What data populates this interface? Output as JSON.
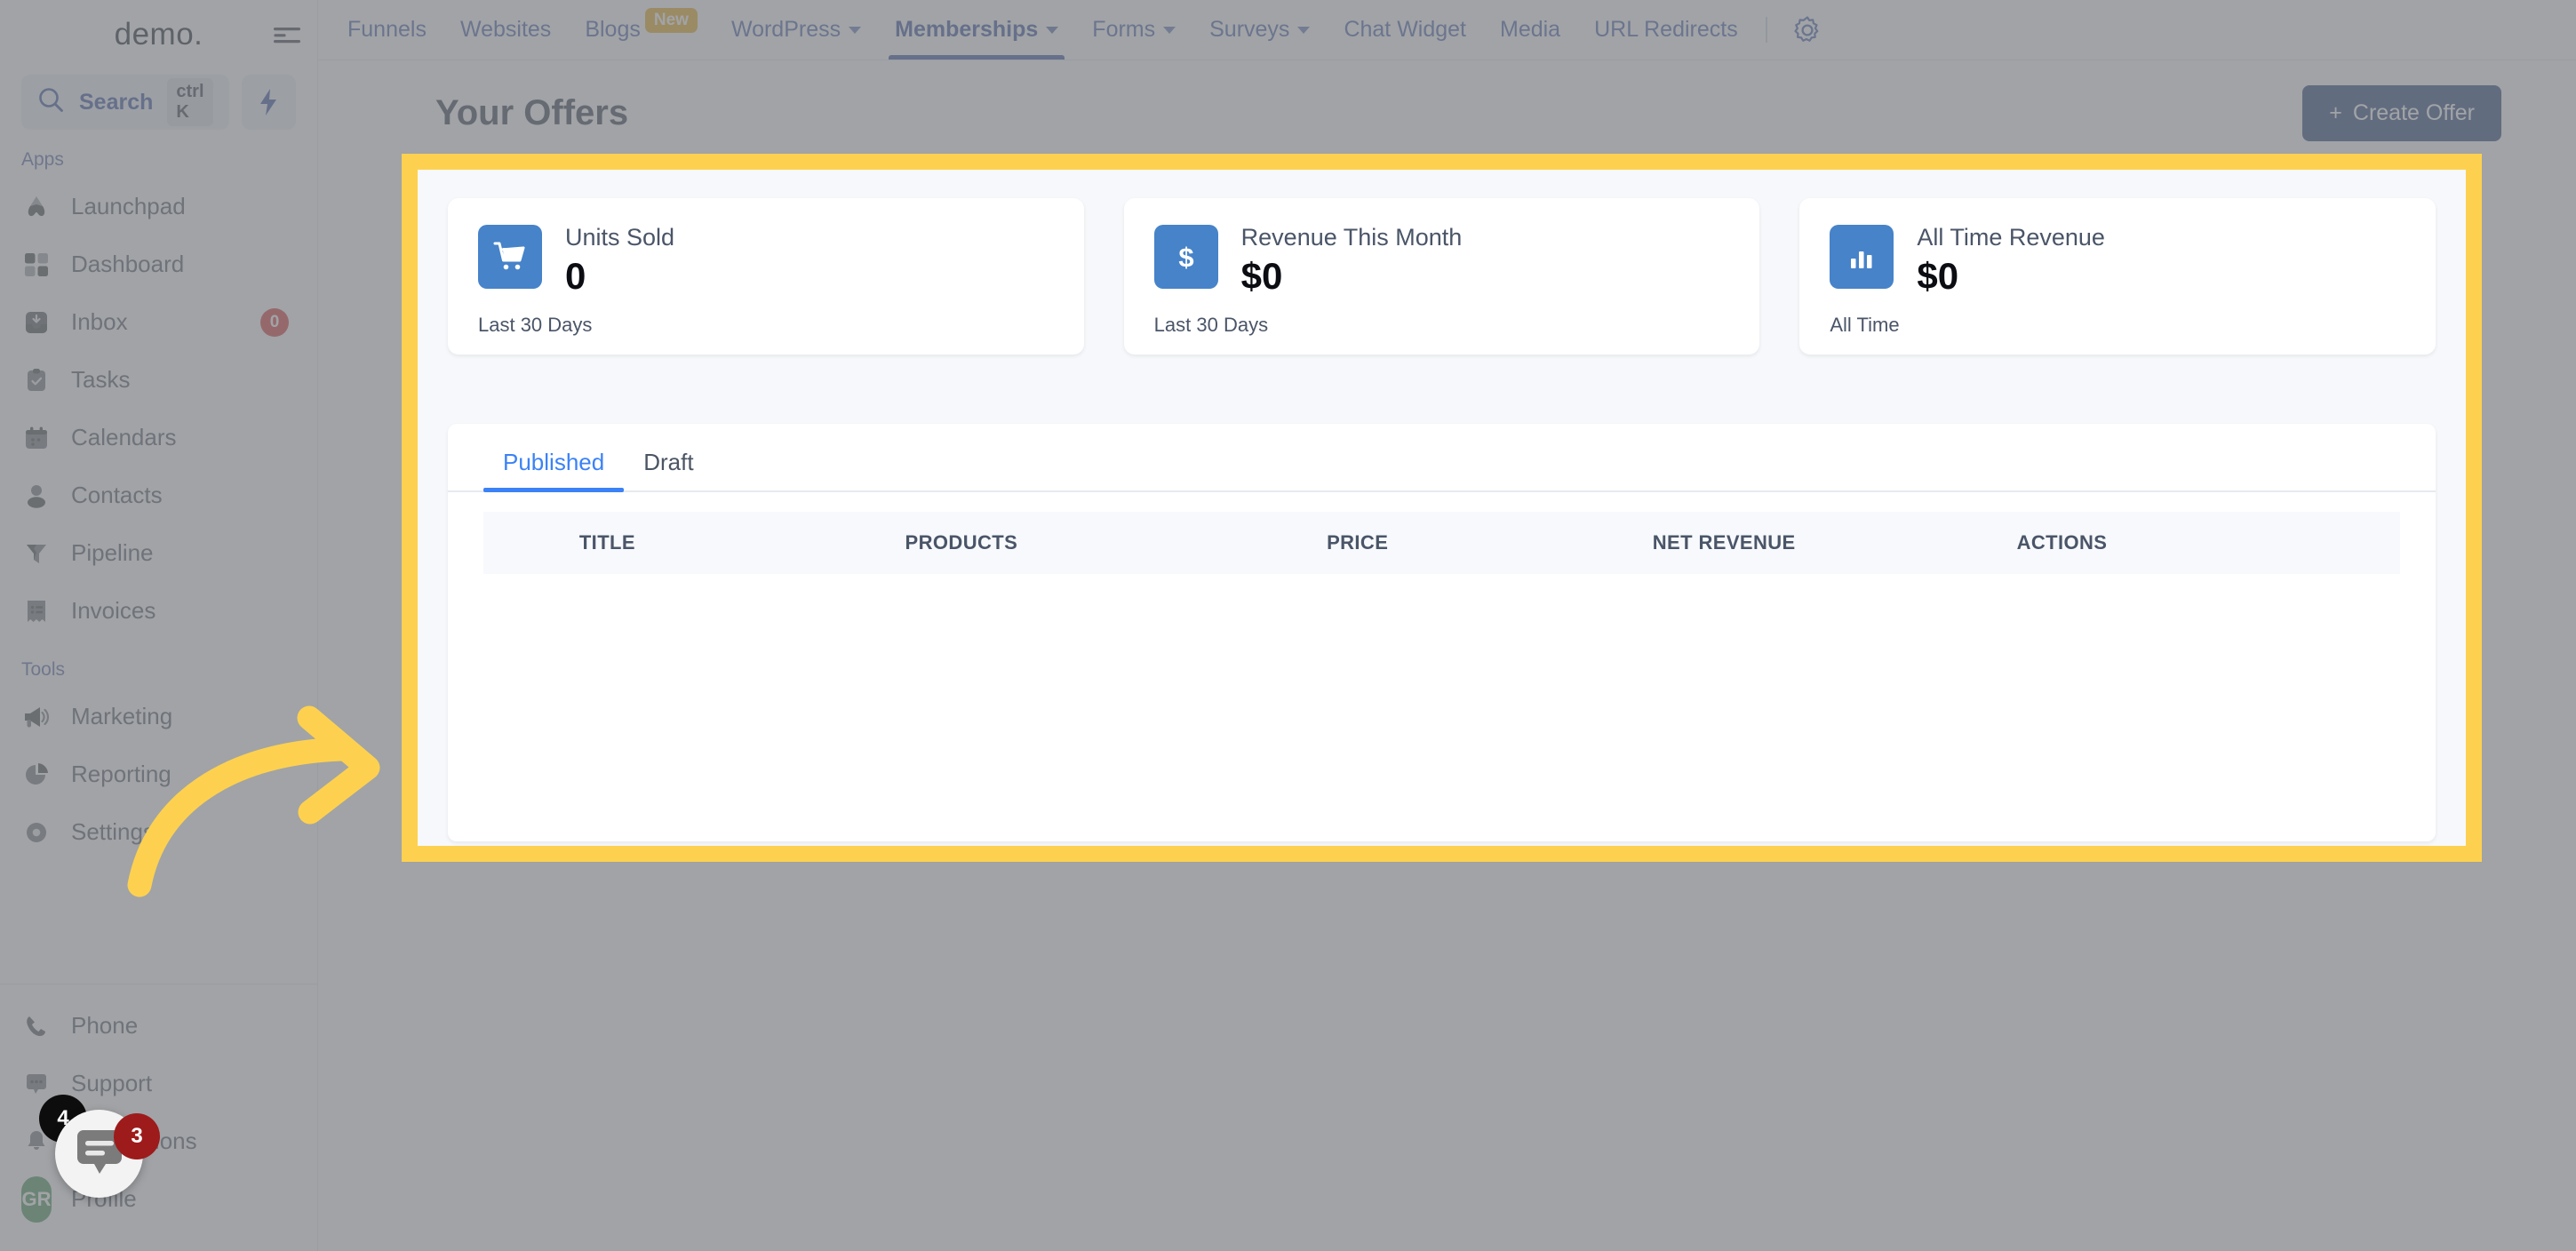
{
  "brand": {
    "logo": "demo."
  },
  "colors": {
    "accent_blue": "#2b4a9b",
    "tab_blue": "#3b82f6",
    "highlight_yellow": "#fdd14f",
    "card_icon_blue": "#4683c9",
    "create_button": "#1f3c75",
    "badge_red": "#d32f2f",
    "new_badge": "#e6a817"
  },
  "sidebar": {
    "search": {
      "label": "Search",
      "shortcut": "ctrl K",
      "icon": "search-icon"
    },
    "quick_action_icon": "lightning-bolt-icon",
    "collapse_icon": "collapse-sidebar-icon",
    "sections": [
      {
        "label": "Apps",
        "items": [
          {
            "label": "Launchpad",
            "icon": "rocket-icon",
            "badge": ""
          },
          {
            "label": "Dashboard",
            "icon": "grid-icon",
            "badge": ""
          },
          {
            "label": "Inbox",
            "icon": "inbox-icon",
            "badge": "0"
          },
          {
            "label": "Tasks",
            "icon": "clipboard-check-icon",
            "badge": ""
          },
          {
            "label": "Calendars",
            "icon": "calendar-icon",
            "badge": ""
          },
          {
            "label": "Contacts",
            "icon": "person-icon",
            "badge": ""
          },
          {
            "label": "Pipeline",
            "icon": "funnel-icon",
            "badge": ""
          },
          {
            "label": "Invoices",
            "icon": "invoice-icon",
            "badge": ""
          }
        ]
      },
      {
        "label": "Tools",
        "items": [
          {
            "label": "Marketing",
            "icon": "megaphone-icon",
            "badge": ""
          },
          {
            "label": "Reporting",
            "icon": "pie-chart-icon",
            "badge": ""
          },
          {
            "label": "Settings",
            "icon": "gear-icon",
            "badge": ""
          }
        ]
      }
    ],
    "bottom_items": [
      {
        "label": "Phone",
        "icon": "phone-icon"
      },
      {
        "label": "Support",
        "icon": "chat-dots-icon"
      },
      {
        "label": "Notifications",
        "icon": "bell-icon"
      },
      {
        "label": "Profile",
        "icon": "avatar-icon",
        "avatar_initials": "GR"
      }
    ]
  },
  "topnav": {
    "items": [
      {
        "label": "Funnels",
        "has_caret": false,
        "badge": "",
        "active": false
      },
      {
        "label": "Websites",
        "has_caret": false,
        "badge": "",
        "active": false
      },
      {
        "label": "Blogs",
        "has_caret": false,
        "badge": "New",
        "active": false
      },
      {
        "label": "WordPress",
        "has_caret": true,
        "badge": "",
        "active": false
      },
      {
        "label": "Memberships",
        "has_caret": true,
        "badge": "",
        "active": true
      },
      {
        "label": "Forms",
        "has_caret": true,
        "badge": "",
        "active": false
      },
      {
        "label": "Surveys",
        "has_caret": true,
        "badge": "",
        "active": false
      },
      {
        "label": "Chat Widget",
        "has_caret": false,
        "badge": "",
        "active": false
      },
      {
        "label": "Media",
        "has_caret": false,
        "badge": "",
        "active": false
      },
      {
        "label": "URL Redirects",
        "has_caret": false,
        "badge": "",
        "active": false
      }
    ],
    "settings_icon": "gear-icon"
  },
  "page": {
    "title": "Your Offers",
    "create_button": {
      "label": "Create Offer",
      "prefix": "+"
    }
  },
  "stat_cards": [
    {
      "icon": "shopping-cart-icon",
      "label": "Units Sold",
      "value": "0",
      "footer": "Last 30 Days"
    },
    {
      "icon": "dollar-sign-icon",
      "label": "Revenue This Month",
      "value": "$0",
      "footer": "Last 30 Days"
    },
    {
      "icon": "bar-chart-icon",
      "label": "All Time Revenue",
      "value": "$0",
      "footer": "All Time"
    }
  ],
  "offers_panel": {
    "tabs": [
      {
        "label": "Published",
        "active": true
      },
      {
        "label": "Draft",
        "active": false
      }
    ],
    "columns": [
      "TITLE",
      "PRODUCTS",
      "PRICE",
      "NET REVENUE",
      "ACTIONS"
    ],
    "rows": []
  },
  "chat_widget": {
    "icon": "chat-bubble-icon",
    "badge_dark": "4",
    "badge_red": "3"
  },
  "annotation": {
    "arrow": "curved-arrow-pointing-right",
    "arrow_color": "#fdd14f",
    "highlight_color": "#fdd14f"
  }
}
